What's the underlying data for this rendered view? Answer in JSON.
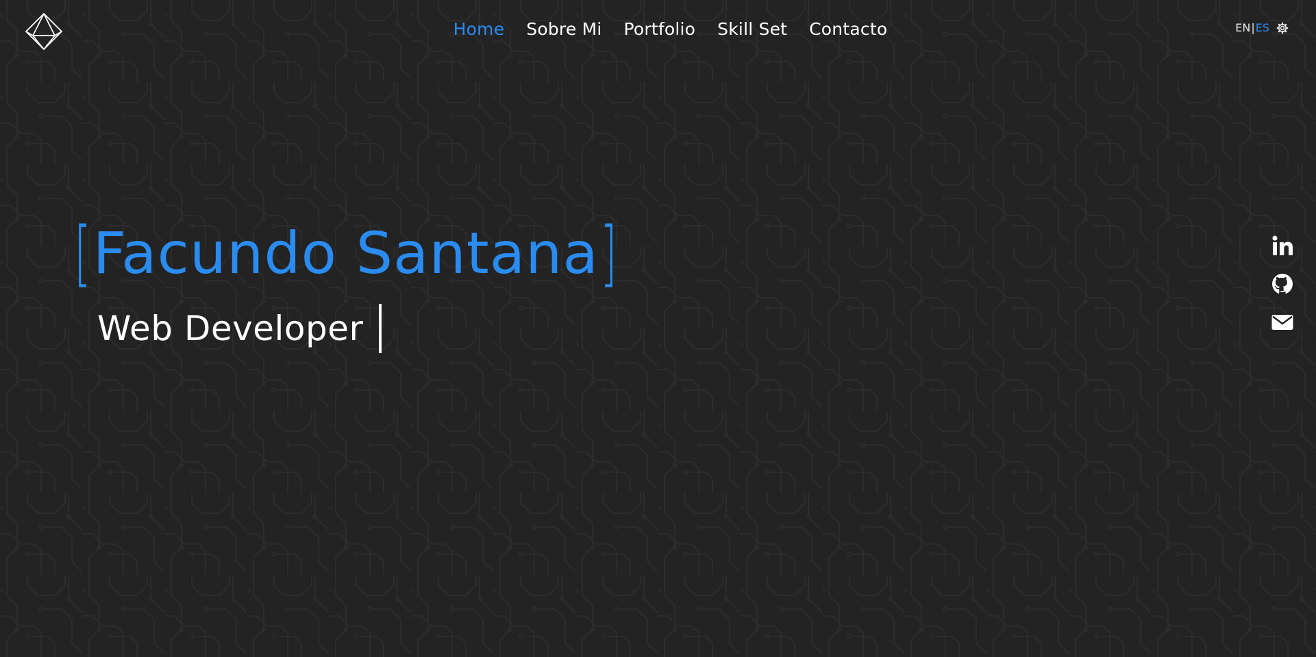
{
  "nav": {
    "items": [
      {
        "label": "Home",
        "active": true
      },
      {
        "label": "Sobre Mi",
        "active": false
      },
      {
        "label": "Portfolio",
        "active": false
      },
      {
        "label": "Skill Set",
        "active": false
      },
      {
        "label": "Contacto",
        "active": false
      }
    ]
  },
  "language": {
    "en": "EN",
    "separator": "|",
    "es": "ES",
    "selected": "ES"
  },
  "hero": {
    "open_bracket": "[",
    "name": "Facundo Santana",
    "close_bracket": "]",
    "role": "Web Developer"
  },
  "icons": {
    "logo": "geometric-diamond-logo",
    "settings": "gear-icon",
    "social": [
      "linkedin-icon",
      "github-icon",
      "email-icon"
    ]
  },
  "colors": {
    "background": "#232323",
    "accent": "#2a8cf0",
    "text": "#ffffff",
    "circuit_lines": "#2c2c2c"
  }
}
